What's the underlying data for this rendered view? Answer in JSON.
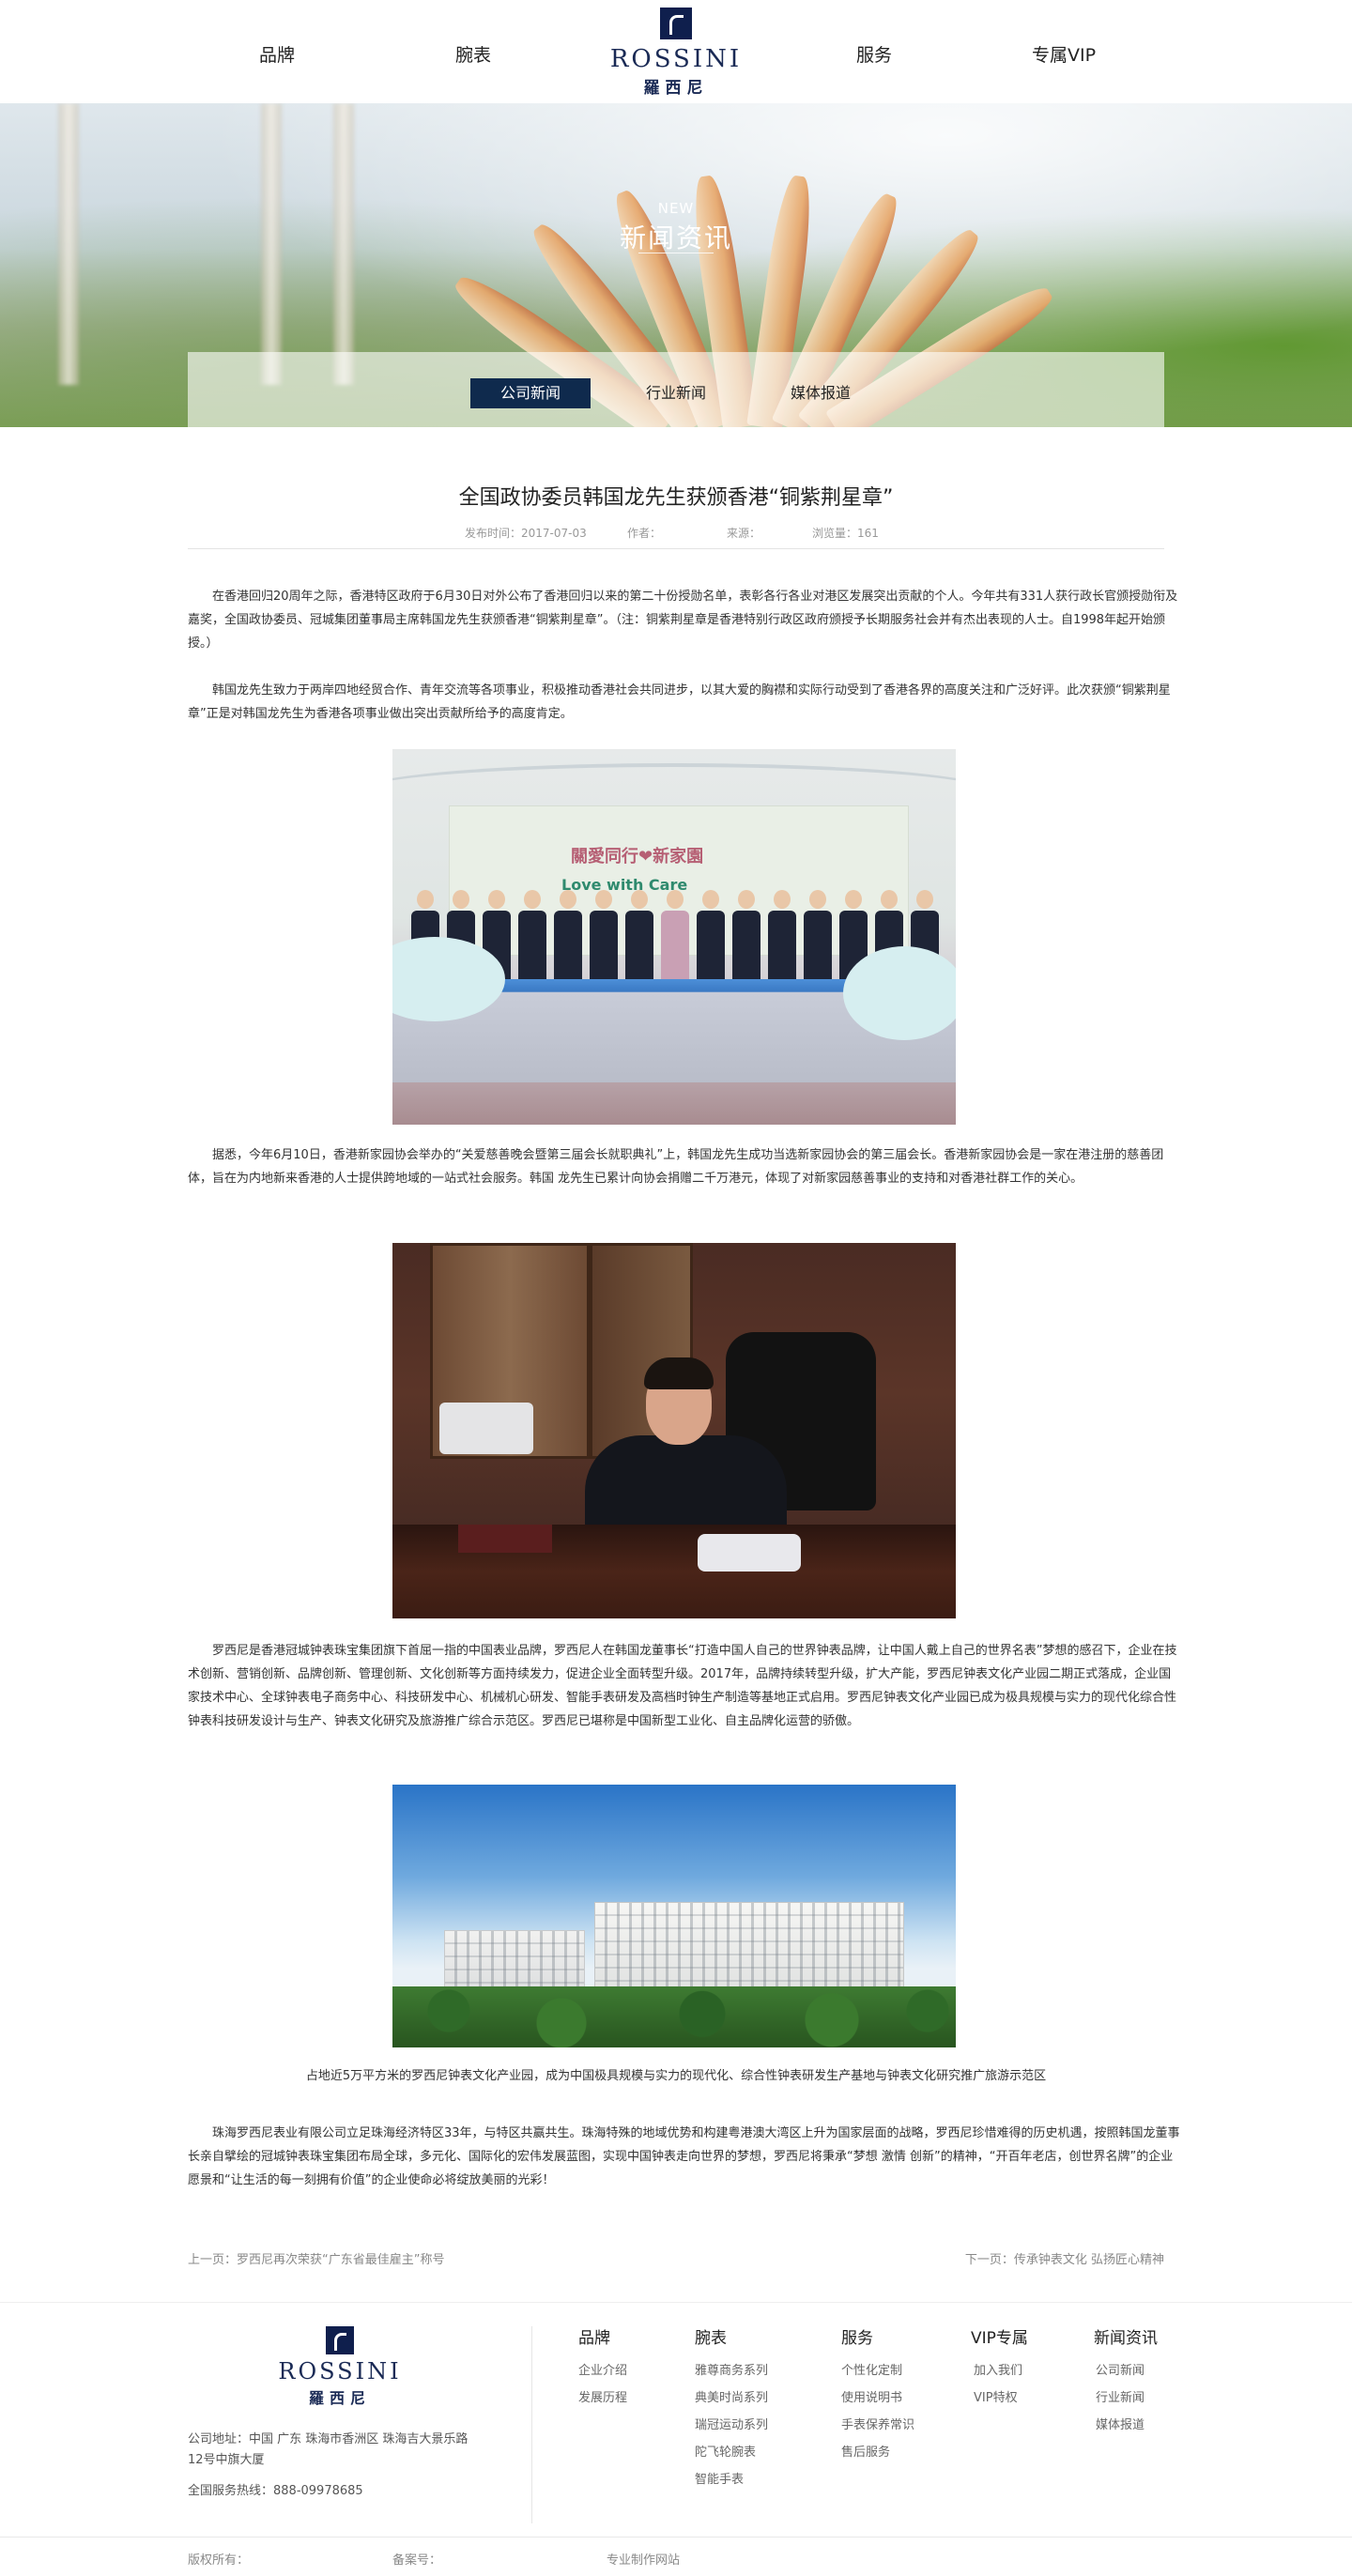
{
  "header": {
    "nav_left": [
      "品牌",
      "腕表"
    ],
    "nav_right": [
      "服务",
      "专属VIP"
    ],
    "logo_word": "ROSSINI",
    "logo_cn": "羅西尼"
  },
  "banner": {
    "title_en": "NEW",
    "title_cn": "新闻资讯",
    "tabs": [
      "公司新闻",
      "行业新闻",
      "媒体报道"
    ],
    "active_tab": "公司新闻"
  },
  "article": {
    "title": "全国政协委员韩国龙先生获颁香港“铜紫荆星章”",
    "meta": {
      "date": "发布时间：2017-07-03",
      "author": "作者：",
      "source": "来源：",
      "views": "浏览量：161"
    },
    "paragraphs": [
      "在香港回归20周年之际，香港特区政府于6月30日对外公布了香港回归以来的第二十份授勋名单，表彰各行各业对港区发展突出贡献的个人。今年共有331人获行政长官颁授勋衔及嘉奖，全国政协委员、冠城集团董事局主席韩国龙先生获颁香港“铜紫荆星章”。（注：铜紫荆星章是香港特别行政区政府颁授予长期服务社会并有杰出表现的人士。自1998年起开始颁授。）",
      "韩国龙先生致力于两岸四地经贸合作、青年交流等各项事业，积极推动香港社会共同进步，以其大爱的胸襟和实际行动受到了香港各界的高度关注和广泛好评。此次获颁“铜紫荆星章”正是对韩国龙先生为香港各项事业做出突出贡献所给予的高度肯定。",
      "据悉，今年6月10日，香港新家园协会举办的“关爱慈善晚会暨第三届会长就职典礼”上，韩国龙先生成功当选新家园协会的第三届会长。香港新家园协会是一家在港注册的慈善团体，旨在为内地新来香港的人士提供跨地域的一站式社会服务。韩国 龙先生已累计向协会捐赠二千万港元，体现了对新家园慈善事业的支持和对香港社群工作的关心。",
      "罗西尼是香港冠城钟表珠宝集团旗下首屈一指的中国表业品牌，罗西尼人在韩国龙董事长“打造中国人自己的世界钟表品牌，让中国人戴上自己的世界名表”梦想的感召下，企业在技术创新、营销创新、品牌创新、管理创新、文化创新等方面持续发力，促进企业全面转型升级。2017年，品牌持续转型升级，扩大产能，罗西尼钟表文化产业园二期正式落成，企业国家技术中心、全球钟表电子商务中心、科技研发中心、机械机心研发、智能手表研发及高档时钟生产制造等基地正式启用。罗西尼钟表文化产业园已成为极具规模与实力的现代化综合性钟表科技研发设计与生产、钟表文化研究及旅游推广综合示范区。罗西尼已堪称是中国新型工业化、自主品牌化运营的骄傲。",
      "珠海罗西尼表业有限公司立足珠海经济特区33年，与特区共赢共生。珠海特殊的地域优势和构建粤港澳大湾区上升为国家层面的战略，罗西尼珍惜难得的历史机遇，按照韩国龙董事长亲自擘绘的冠城钟表珠宝集团布局全球，多元化、国际化的宏伟发展蓝图，实现中国钟表走向世界的梦想，罗西尼将秉承“梦想 激情 创新”的精神，“开百年老店，创世界名牌”的企业愿景和“让生活的每一刻拥有价值”的企业使命必将绽放美丽的光彩！"
    ],
    "photo1_backdrop_cn": "關愛同行❤新家園",
    "photo1_backdrop_en": "Love with Care",
    "caption": "占地近5万平方米的罗西尼钟表文化产业园，成为中国极具规模与实力的现代化、综合性钟表研发生产基地与钟表文化研究推广旅游示范区"
  },
  "pager": {
    "prev": "上一页：罗西尼再次荣获“广东省最佳雇主”称号",
    "next": "下一页：传承钟表文化 弘扬匠心精神"
  },
  "footer": {
    "address": "公司地址：中国 广东 珠海市香洲区 珠海吉大景乐路",
    "address2": "12号中旗大厦",
    "hotline": "全国服务热线：888-09978685",
    "columns": [
      {
        "title": "品牌",
        "links": [
          "企业介绍",
          "发展历程"
        ]
      },
      {
        "title": "腕表",
        "links": [
          "雅尊商务系列",
          "典美时尚系列",
          "瑞冠运动系列",
          "陀飞轮腕表",
          "智能手表"
        ]
      },
      {
        "title": "服务",
        "links": [
          "个性化定制",
          "使用说明书",
          "手表保养常识",
          "售后服务"
        ]
      },
      {
        "title": "VIP专属",
        "links": [
          "加入我们",
          "VIP特权"
        ]
      },
      {
        "title": "新闻资讯",
        "links": [
          "公司新闻",
          "行业新闻",
          "媒体报道"
        ]
      }
    ],
    "copyright": "版权所有：",
    "icp": "备案号：",
    "maker": "专业制作网站"
  },
  "colors": {
    "brand_navy": "#0f2a4d",
    "logo_blue": "#1a2a55"
  }
}
